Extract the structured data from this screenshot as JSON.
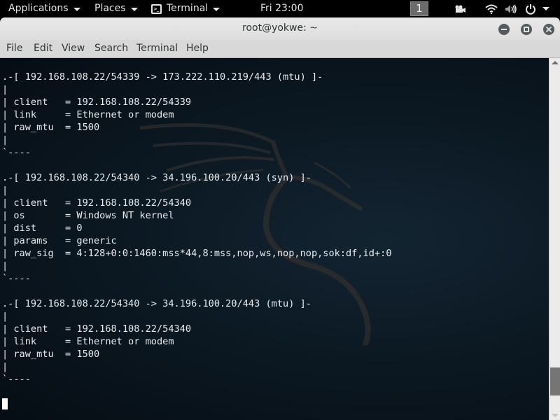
{
  "topbar": {
    "applications_label": "Applications",
    "places_label": "Places",
    "terminal_label": "Terminal",
    "clock": "Fri 23:00",
    "workspace_number": "1",
    "tray_icons": [
      "video-camera-icon",
      "wifi-icon",
      "volume-icon",
      "power-icon",
      "chevron-down-icon"
    ]
  },
  "window": {
    "title": "root@yokwe: ~",
    "controls": [
      "minimize",
      "maximize",
      "close"
    ]
  },
  "menubar": {
    "items": [
      "File",
      "Edit",
      "View",
      "Search",
      "Terminal",
      "Help"
    ]
  },
  "terminal": {
    "lines": [
      ".-[ 192.168.108.22/54339 -> 173.222.110.219/443 (mtu) ]-",
      "|",
      "| client   = 192.168.108.22/54339",
      "| link     = Ethernet or modem",
      "| raw_mtu  = 1500",
      "|",
      "`----",
      "",
      ".-[ 192.168.108.22/54340 -> 34.196.100.20/443 (syn) ]-",
      "|",
      "| client   = 192.168.108.22/54340",
      "| os       = Windows NT kernel",
      "| dist     = 0",
      "| params   = generic",
      "| raw_sig  = 4:128+0:0:1460:mss*44,8:mss,nop,ws,nop,nop,sok:df,id+:0",
      "|",
      "`----",
      "",
      ".-[ 192.168.108.22/54340 -> 34.196.100.20/443 (mtu) ]-",
      "|",
      "| client   = 192.168.108.22/54340",
      "| link     = Ethernet or modem",
      "| raw_mtu  = 1500",
      "|",
      "`----"
    ]
  },
  "scrollbar": {
    "position_fraction": 0.95
  }
}
